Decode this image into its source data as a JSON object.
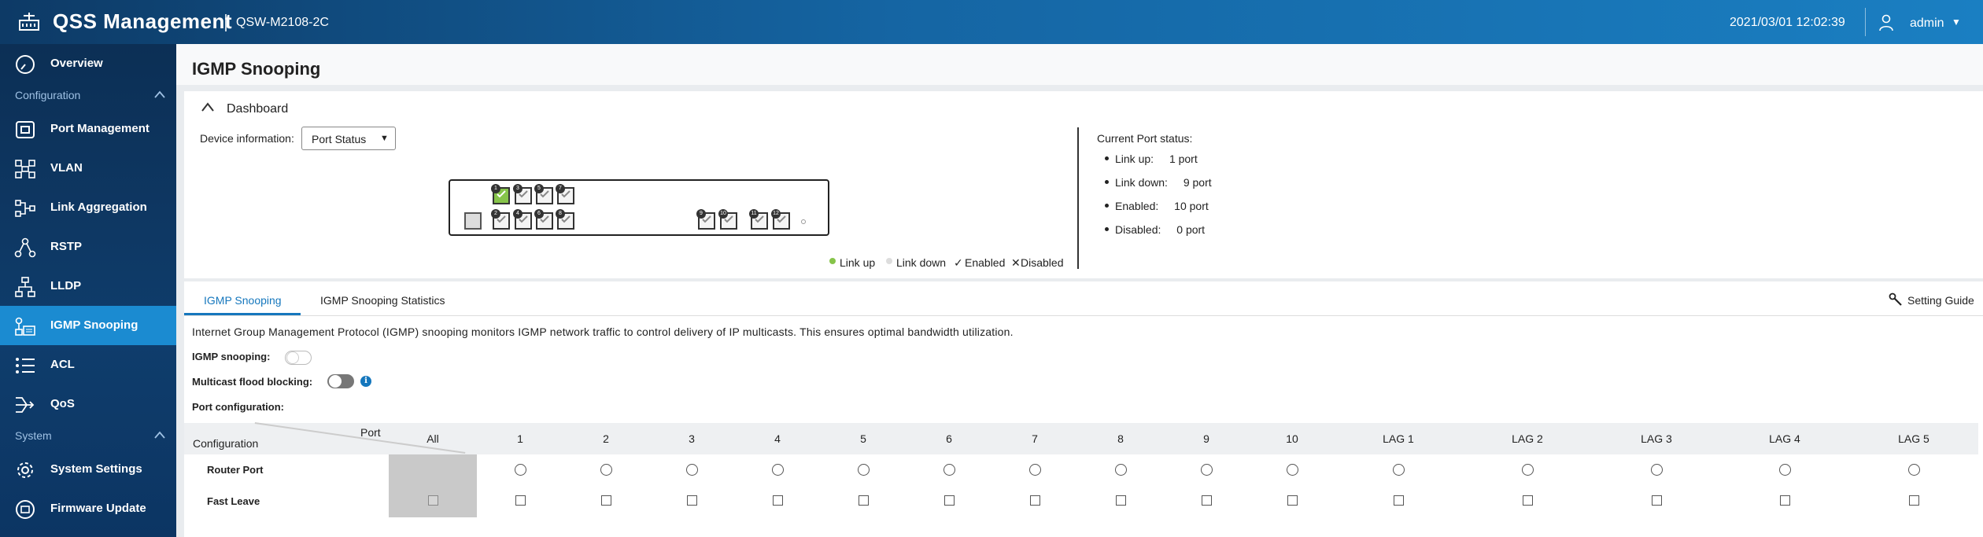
{
  "app": {
    "title": "QSS Management",
    "model": "QSW-M2108-2C",
    "datetime": "2021/03/01 12:02:39",
    "user": "admin"
  },
  "colors": {
    "accent": "#1577bd",
    "active_nav": "#1b8bd1",
    "link_up": "#86c44a"
  },
  "sidebar": {
    "overview": "Overview",
    "configuration_section": "Configuration",
    "items": [
      {
        "label": "Port Management",
        "icon": "port-icon"
      },
      {
        "label": "VLAN",
        "icon": "vlan-icon"
      },
      {
        "label": "Link Aggregation",
        "icon": "link-aggregation-icon"
      },
      {
        "label": "RSTP",
        "icon": "rstp-icon"
      },
      {
        "label": "LLDP",
        "icon": "lldp-icon"
      },
      {
        "label": "IGMP Snooping",
        "icon": "igmp-icon",
        "active": true
      },
      {
        "label": "ACL",
        "icon": "acl-icon"
      },
      {
        "label": "QoS",
        "icon": "qos-icon"
      }
    ],
    "system_section": "System",
    "system_items": [
      {
        "label": "System Settings",
        "icon": "gear-icon"
      },
      {
        "label": "Firmware Update",
        "icon": "firmware-icon"
      }
    ]
  },
  "page": {
    "title": "IGMP Snooping"
  },
  "dashboard": {
    "title": "Dashboard",
    "device_info_label": "Device information:",
    "device_select_value": "Port Status",
    "switch_ports": {
      "top_row": [
        "1",
        "3",
        "5",
        "7"
      ],
      "bottom_row": [
        "2",
        "4",
        "6",
        "8"
      ],
      "right_ports": [
        "9",
        "10"
      ],
      "lag_ports": [
        "11",
        "12"
      ],
      "link_up_ports": [
        "1"
      ]
    },
    "legend": {
      "link_up": "Link up",
      "link_down": "Link down",
      "enabled": "Enabled",
      "disabled": "Disabled"
    },
    "status_title": "Current Port status:",
    "status": [
      {
        "label": "Link up:",
        "value": "1 port"
      },
      {
        "label": "Link down:",
        "value": "9 port"
      },
      {
        "label": "Enabled:",
        "value": "10 port"
      },
      {
        "label": "Disabled:",
        "value": "0 port"
      }
    ]
  },
  "tabs": {
    "igmp": "IGMP Snooping",
    "stats": "IGMP Snooping Statistics",
    "guide": "Setting Guide"
  },
  "config": {
    "description": "Internet Group Management Protocol (IGMP) snooping monitors IGMP network traffic to control delivery of IP multicasts. This ensures optimal bandwidth utilization.",
    "igmp_snooping_label": "IGMP snooping:",
    "igmp_snooping_enabled": false,
    "flood_blocking_label": "Multicast flood blocking:",
    "flood_blocking_enabled": false,
    "port_config_label": "Port configuration:"
  },
  "table": {
    "port_header": "Port",
    "config_header": "Configuration",
    "columns": [
      "All",
      "1",
      "2",
      "3",
      "4",
      "5",
      "6",
      "7",
      "8",
      "9",
      "10",
      "LAG 1",
      "LAG 2",
      "LAG 3",
      "LAG 4",
      "LAG 5"
    ],
    "rows": [
      {
        "name": "Router Port",
        "type": "radio"
      },
      {
        "name": "Fast Leave",
        "type": "checkbox"
      }
    ]
  }
}
